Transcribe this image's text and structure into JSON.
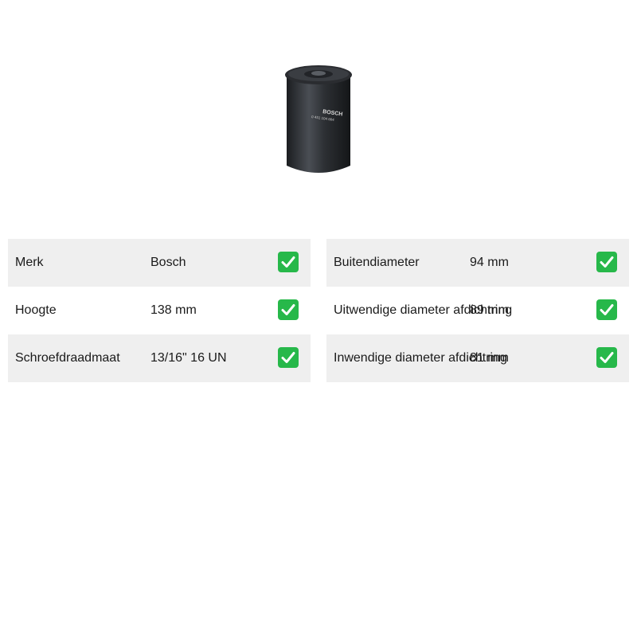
{
  "product": {
    "image_icon": "oil-filter-image",
    "brand_print": "BOSCH",
    "part_number_print": "0 451 104 664"
  },
  "specs_left": [
    {
      "label": "Merk",
      "value": "Bosch"
    },
    {
      "label": "Hoogte",
      "value": "138 mm"
    },
    {
      "label": "Schroefdraadmaat",
      "value": "13/16\" 16 UN"
    }
  ],
  "specs_right": [
    {
      "label": "Buitendiameter",
      "value": "94 mm"
    },
    {
      "label": "Uitwendige diameter afdichtring",
      "value": "89 mm"
    },
    {
      "label": "Inwendige diameter afdichtring",
      "value": "81 mm"
    }
  ],
  "check_icon": "check-mark-button-icon",
  "colors": {
    "row_shade": "#efefef",
    "check_green": "#27b84a"
  }
}
